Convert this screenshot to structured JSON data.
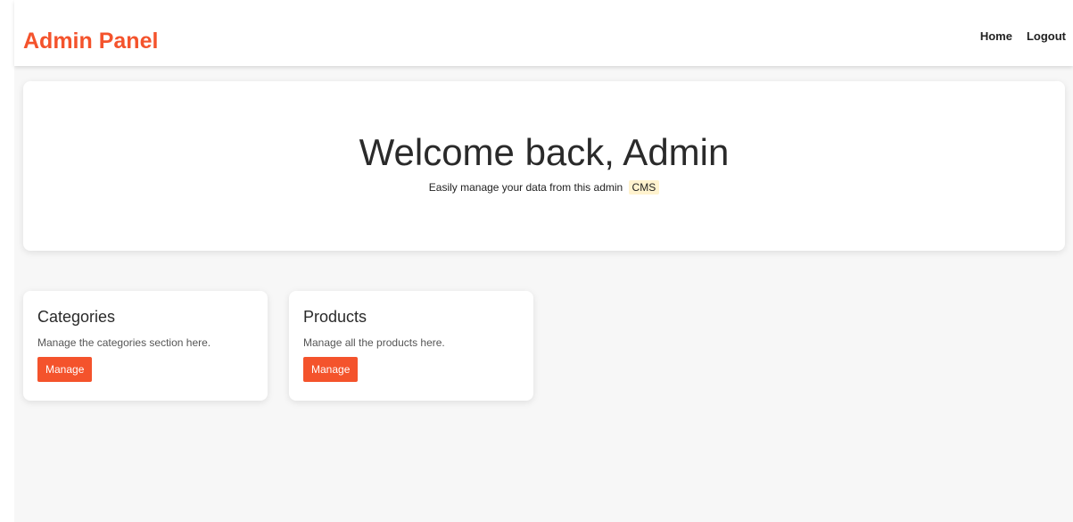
{
  "header": {
    "brand": "Admin Panel",
    "links": [
      {
        "label": "Home"
      },
      {
        "label": "Logout"
      }
    ]
  },
  "hero": {
    "title": "Welcome back, Admin",
    "subtitle": "Easily manage your data from this admin",
    "highlight": "CMS"
  },
  "cards": [
    {
      "title": "Categories",
      "description": "Manage the categories section here.",
      "button_label": "Manage"
    },
    {
      "title": "Products",
      "description": "Manage all the products here.",
      "button_label": "Manage"
    }
  ],
  "colors": {
    "accent": "#f4532c",
    "background": "#f7f7f7",
    "card": "#ffffff",
    "highlight": "#fff3cf"
  }
}
